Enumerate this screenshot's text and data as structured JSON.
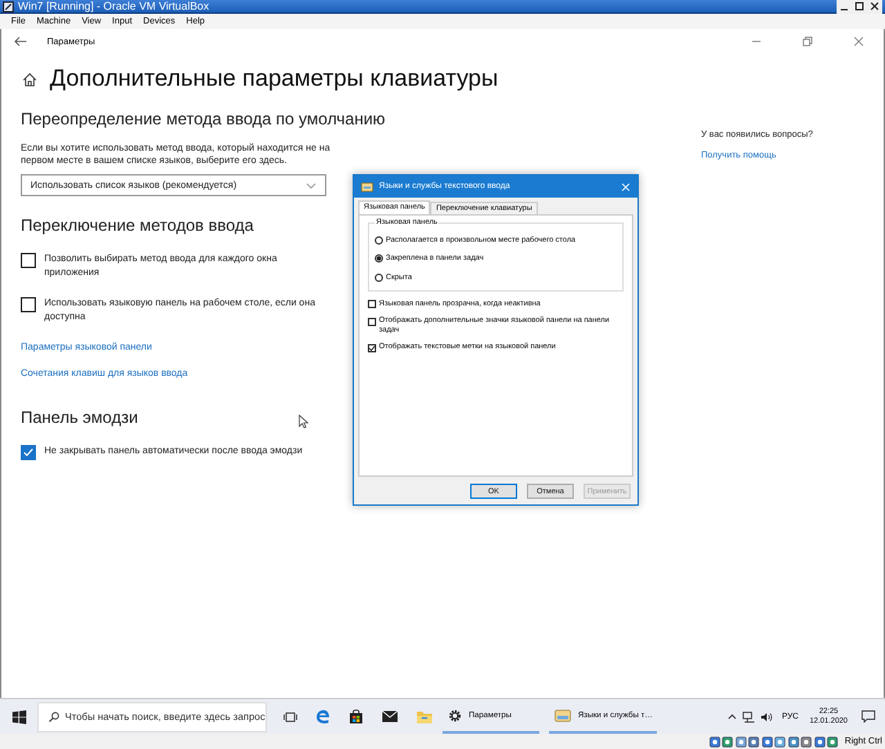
{
  "vm_window": {
    "title": "Win7 [Running] - Oracle VM VirtualBox",
    "menu": [
      "File",
      "Machine",
      "View",
      "Input",
      "Devices",
      "Help"
    ],
    "host_key": "Right Ctrl"
  },
  "settings": {
    "app_title": "Параметры",
    "page_title": "Дополнительные параметры клавиатуры",
    "items": [
      {
        "kind": "heading",
        "text": "Переопределение метода ввода по умолчанию"
      },
      {
        "kind": "paragraph",
        "text": "Если вы хотите использовать метод ввода, который находится не на первом месте в вашем списке языков, выберите его здесь."
      },
      {
        "kind": "dropdown",
        "text": "Использовать список языков (рекомендуется)"
      },
      {
        "kind": "heading",
        "text": "Переключение методов ввода"
      },
      {
        "kind": "checkbox",
        "text": "Позволить выбирать метод ввода для каждого окна приложения",
        "checked": false
      },
      {
        "kind": "checkbox",
        "text": "Использовать языковую панель на рабочем столе, если она доступна",
        "checked": false
      },
      {
        "kind": "link",
        "text": "Параметры языковой панели"
      },
      {
        "kind": "link",
        "text": "Сочетания клавиш для языков ввода"
      },
      {
        "kind": "heading",
        "text": "Панель эмодзи"
      },
      {
        "kind": "checkbox",
        "text": "Не закрывать панель автоматически после ввода эмодзи",
        "checked": true
      }
    ],
    "help": {
      "question": "У вас появились вопросы?",
      "link": "Получить помощь"
    }
  },
  "dialog": {
    "title": "Языки и службы текстового ввода",
    "tabs": [
      {
        "label": "Языковая панель",
        "selected": true
      },
      {
        "label": "Переключение клавиатуры",
        "selected": false
      }
    ],
    "group": {
      "legend": "Языковая панель",
      "options": [
        {
          "label": "Располагается в произвольном месте рабочего стола",
          "selected": false
        },
        {
          "label": "Закреплена в панели задач",
          "selected": true
        },
        {
          "label": "Скрыта",
          "selected": false
        }
      ]
    },
    "checkboxes": [
      {
        "label": "Языковая панель прозрачна, когда неактивна",
        "checked": false
      },
      {
        "label": "Отображать дополнительные значки языковой панели на панели задач",
        "checked": false
      },
      {
        "label": "Отображать текстовые метки на языковой панели",
        "checked": true
      }
    ],
    "buttons": [
      {
        "label": "OK",
        "disabled": false
      },
      {
        "label": "Отмена",
        "disabled": false
      },
      {
        "label": "Применить",
        "disabled": true
      }
    ]
  },
  "taskbar": {
    "search_placeholder": "Чтобы начать поиск, введите здесь запрос",
    "tasks": [
      {
        "kind": "settings",
        "label": "Параметры"
      },
      {
        "kind": "dialog",
        "label": "Языки и службы т…"
      }
    ],
    "language": "РУС",
    "time": "22:25",
    "date": "12.01.2020"
  }
}
